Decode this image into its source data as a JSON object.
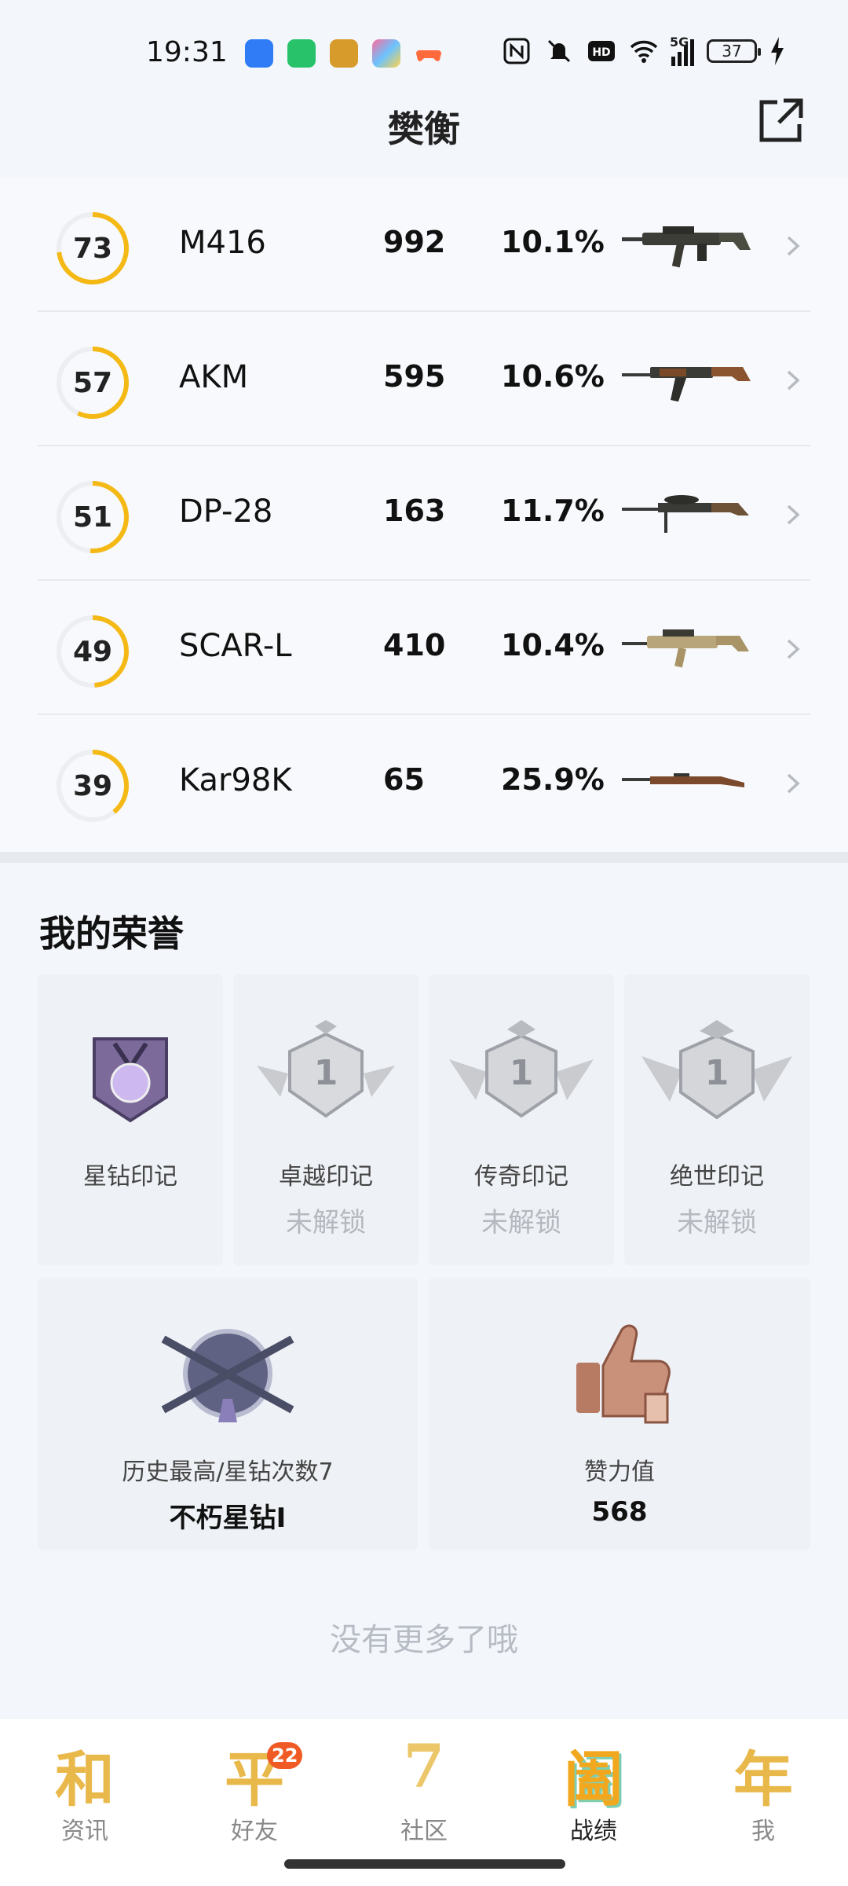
{
  "status_bar": {
    "time": "19:31",
    "battery": "37",
    "network": "5G",
    "hd": "HD"
  },
  "header": {
    "title": "樊衡"
  },
  "weapons": [
    {
      "score": "73",
      "progress": 0.73,
      "name": "M416",
      "count": "992",
      "pct": "10.1%"
    },
    {
      "score": "57",
      "progress": 0.57,
      "name": "AKM",
      "count": "595",
      "pct": "10.6%"
    },
    {
      "score": "51",
      "progress": 0.51,
      "name": "DP-28",
      "count": "163",
      "pct": "11.7%"
    },
    {
      "score": "49",
      "progress": 0.49,
      "name": "SCAR-L",
      "count": "410",
      "pct": "10.4%"
    },
    {
      "score": "39",
      "progress": 0.39,
      "name": "Kar98K",
      "count": "65",
      "pct": "25.9%"
    }
  ],
  "honors": {
    "title": "我的荣誉",
    "marks": [
      {
        "label": "星钻印记",
        "status": ""
      },
      {
        "label": "卓越印记",
        "status": "未解锁"
      },
      {
        "label": "传奇印记",
        "status": "未解锁"
      },
      {
        "label": "绝世印记",
        "status": "未解锁"
      }
    ],
    "rank": {
      "label": "历史最高/星钻次数7",
      "value": "不朽星钻I"
    },
    "likes": {
      "label": "赞力值",
      "value": "568"
    }
  },
  "footer_text": "没有更多了哦",
  "nav": [
    {
      "glyph": "和",
      "label": "资讯",
      "active": false
    },
    {
      "glyph": "平",
      "label": "好友",
      "badge": "22",
      "active": false
    },
    {
      "glyph": "7",
      "label": "社区",
      "active": false
    },
    {
      "glyph": "阖",
      "label": "战绩",
      "active": true
    },
    {
      "glyph": "年",
      "label": "我",
      "active": false
    }
  ],
  "colors": {
    "ring": "#f5b915",
    "ring_track": "#eceef2",
    "nav_glyph": "#e9b23c",
    "badge": "#f05a24"
  }
}
